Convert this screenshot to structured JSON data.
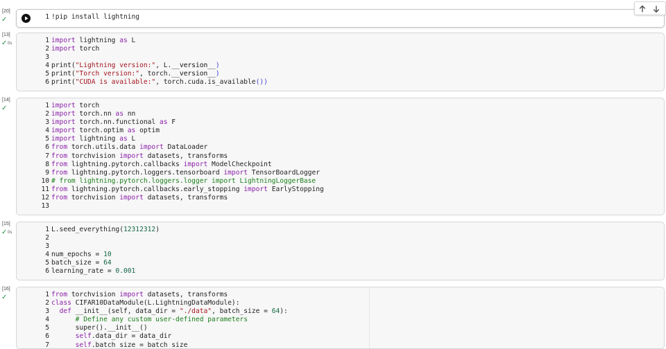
{
  "toolbar": {
    "up_icon": "arrow-up-icon",
    "down_icon": "arrow-down-icon"
  },
  "run_icon": "play-circle-icon",
  "status_icon": "checkmark-icon",
  "cells": [
    {
      "count": "[20]",
      "duration": "",
      "lines": [
        [
          {
            "t": "!pip install lightning"
          }
        ]
      ]
    },
    {
      "count": "[13]",
      "duration": "0s",
      "lines": [
        [
          {
            "t": "import",
            "c": "kw"
          },
          {
            "t": " lightning "
          },
          {
            "t": "as",
            "c": "kw"
          },
          {
            "t": " L"
          }
        ],
        [
          {
            "t": "import",
            "c": "kw"
          },
          {
            "t": " torch"
          }
        ],
        [],
        [
          {
            "t": "print("
          },
          {
            "t": "\"Lightning version:\"",
            "c": "str"
          },
          {
            "t": ", L."
          },
          {
            "t": "__version__",
            "c": "dun"
          },
          {
            "t": ")",
            "c": "paren"
          }
        ],
        [
          {
            "t": "print("
          },
          {
            "t": "\"Torch version:\"",
            "c": "str"
          },
          {
            "t": ", torch."
          },
          {
            "t": "__version__",
            "c": "dun"
          },
          {
            "t": ")",
            "c": "paren"
          }
        ],
        [
          {
            "t": "print("
          },
          {
            "t": "\"CUDA is available:\"",
            "c": "str"
          },
          {
            "t": ", torch.cuda.is_available"
          },
          {
            "t": "())",
            "c": "paren"
          }
        ]
      ]
    },
    {
      "count": "[14]",
      "duration": "",
      "lines": [
        [
          {
            "t": "import",
            "c": "kw"
          },
          {
            "t": " torch"
          }
        ],
        [
          {
            "t": "import",
            "c": "kw"
          },
          {
            "t": " torch.nn "
          },
          {
            "t": "as",
            "c": "kw"
          },
          {
            "t": " nn"
          }
        ],
        [
          {
            "t": "import",
            "c": "kw"
          },
          {
            "t": " torch.nn.functional "
          },
          {
            "t": "as",
            "c": "kw"
          },
          {
            "t": " F"
          }
        ],
        [
          {
            "t": "import",
            "c": "kw"
          },
          {
            "t": " torch.optim "
          },
          {
            "t": "as",
            "c": "kw"
          },
          {
            "t": " optim"
          }
        ],
        [
          {
            "t": "import",
            "c": "kw"
          },
          {
            "t": " lightning "
          },
          {
            "t": "as",
            "c": "kw"
          },
          {
            "t": " L"
          }
        ],
        [
          {
            "t": "from",
            "c": "kw"
          },
          {
            "t": " torch.utils.data "
          },
          {
            "t": "import",
            "c": "kw"
          },
          {
            "t": " DataLoader"
          }
        ],
        [
          {
            "t": "from",
            "c": "kw"
          },
          {
            "t": " torchvision "
          },
          {
            "t": "import",
            "c": "kw"
          },
          {
            "t": " datasets, transforms"
          }
        ],
        [
          {
            "t": "from",
            "c": "kw"
          },
          {
            "t": " lightning.pytorch.callbacks "
          },
          {
            "t": "import",
            "c": "kw"
          },
          {
            "t": " ModelCheckpoint"
          }
        ],
        [
          {
            "t": "from",
            "c": "kw"
          },
          {
            "t": " lightning.pytorch.loggers.tensorboard "
          },
          {
            "t": "import",
            "c": "kw"
          },
          {
            "t": " TensorBoardLogger"
          }
        ],
        [
          {
            "t": "# from lightning.pytorch.loggers.logger import LightningLoggerBase",
            "c": "cmt"
          }
        ],
        [
          {
            "t": "from",
            "c": "kw"
          },
          {
            "t": " lightning.pytorch.callbacks.early_stopping "
          },
          {
            "t": "import",
            "c": "kw"
          },
          {
            "t": " EarlyStopping"
          }
        ],
        [
          {
            "t": "from",
            "c": "kw"
          },
          {
            "t": " torchvision "
          },
          {
            "t": "import",
            "c": "kw"
          },
          {
            "t": " datasets, transforms"
          }
        ],
        []
      ]
    },
    {
      "count": "[15]",
      "duration": "0s",
      "lines": [
        [
          {
            "t": "L.seed_everything("
          },
          {
            "t": "12312312",
            "c": "num"
          },
          {
            "t": ")"
          }
        ],
        [],
        [],
        [
          {
            "t": "num_epochs = "
          },
          {
            "t": "10",
            "c": "num"
          }
        ],
        [
          {
            "t": "batch_size = "
          },
          {
            "t": "64",
            "c": "num"
          }
        ],
        [
          {
            "t": "learning_rate = "
          },
          {
            "t": "0.001",
            "c": "num"
          }
        ]
      ]
    },
    {
      "count": "[16]",
      "duration": "",
      "lines": [
        [
          {
            "t": "from",
            "c": "kw"
          },
          {
            "t": " torchvision "
          },
          {
            "t": "import",
            "c": "kw"
          },
          {
            "t": " datasets, transforms"
          }
        ],
        [
          {
            "t": "class",
            "c": "kw"
          },
          {
            "t": " CIFAR10DataModule(L.LightningDataModule):"
          }
        ],
        [
          {
            "t": "  "
          },
          {
            "t": "def",
            "c": "kw"
          },
          {
            "t": " __init__(self, data_dir = "
          },
          {
            "t": "\"./data\"",
            "c": "str"
          },
          {
            "t": ", batch_size = "
          },
          {
            "t": "64",
            "c": "num"
          },
          {
            "t": "):"
          }
        ],
        [
          {
            "t": "      "
          },
          {
            "t": "# Define any custom user-defined parameters",
            "c": "cmt"
          }
        ],
        [
          {
            "t": "      super().__init__()"
          }
        ],
        [
          {
            "t": "      "
          },
          {
            "t": "self",
            "c": "kw"
          },
          {
            "t": ".data_dir = data_dir"
          }
        ],
        [
          {
            "t": "      "
          },
          {
            "t": "self",
            "c": "kw"
          },
          {
            "t": ".batch_size = batch_size"
          }
        ]
      ]
    }
  ]
}
